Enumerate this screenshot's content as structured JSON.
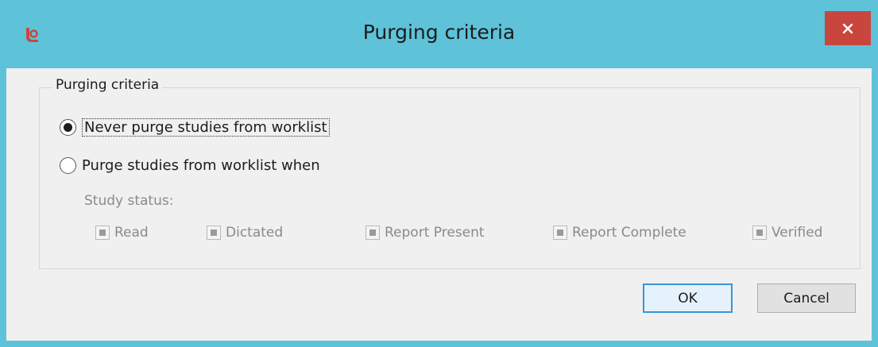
{
  "window": {
    "title": "Purging criteria",
    "app_icon": "app-logo-icon",
    "close_icon": "close-icon",
    "colors": {
      "titlebar": "#5ec3d9",
      "close": "#c9463f",
      "accent": "#3b94d6"
    }
  },
  "group": {
    "title": "Purging criteria",
    "options": [
      {
        "label": "Never purge studies from worklist",
        "selected": true
      },
      {
        "label": "Purge studies from worklist when",
        "selected": false
      }
    ],
    "study_status_label": "Study status:",
    "statuses": [
      "Read",
      "Dictated",
      "Report Present",
      "Report Complete",
      "Verified"
    ]
  },
  "buttons": {
    "ok": "OK",
    "cancel": "Cancel"
  }
}
